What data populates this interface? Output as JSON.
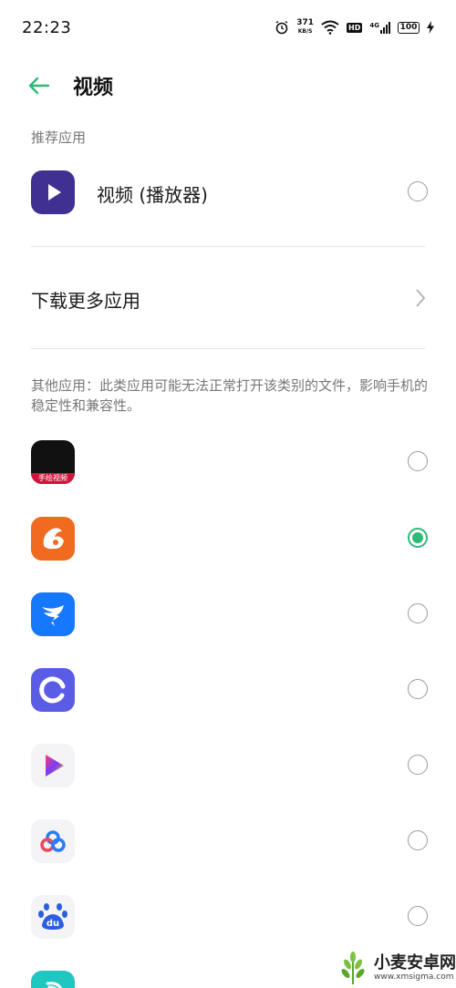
{
  "status_bar": {
    "time": "22:23",
    "network_speed_value": "371",
    "network_speed_unit": "KB/S",
    "hd_label": "HD",
    "signal_label": "4G",
    "battery_level": "100",
    "icons": [
      "alarm-icon",
      "wifi-icon",
      "hd-icon",
      "signal-icon",
      "battery-icon",
      "charging-icon"
    ]
  },
  "header": {
    "title": "视频",
    "back_icon": "arrow-left-icon",
    "accent_color": "#2fb977"
  },
  "recommended": {
    "section_label": "推荐应用",
    "app": {
      "name": "视频 (播放器)",
      "icon": "video-player-icon",
      "selected": false
    }
  },
  "download_more": {
    "label": "下载更多应用",
    "icon": "chevron-right-icon"
  },
  "other_apps": {
    "notice": "其他应用：此类应用可能无法正常打开该类别的文件，影响手机的稳定性和兼容性。",
    "items": [
      {
        "icon": "shoujing-video-icon",
        "icon_text": "手绘视频",
        "selected": false
      },
      {
        "icon": "uc-browser-icon",
        "selected": true
      },
      {
        "icon": "dingtalk-icon",
        "selected": false
      },
      {
        "icon": "circle-app-icon",
        "selected": false
      },
      {
        "icon": "video-play-app-icon",
        "selected": false
      },
      {
        "icon": "baidu-netdisk-icon",
        "selected": false
      },
      {
        "icon": "baidu-paw-icon",
        "icon_text": "du",
        "selected": false
      },
      {
        "icon": "teal-app-icon",
        "selected": false
      }
    ]
  },
  "watermark": {
    "title": "小麦安卓网",
    "url": "www.xmsigma.com",
    "icon": "wheat-logo-icon"
  }
}
